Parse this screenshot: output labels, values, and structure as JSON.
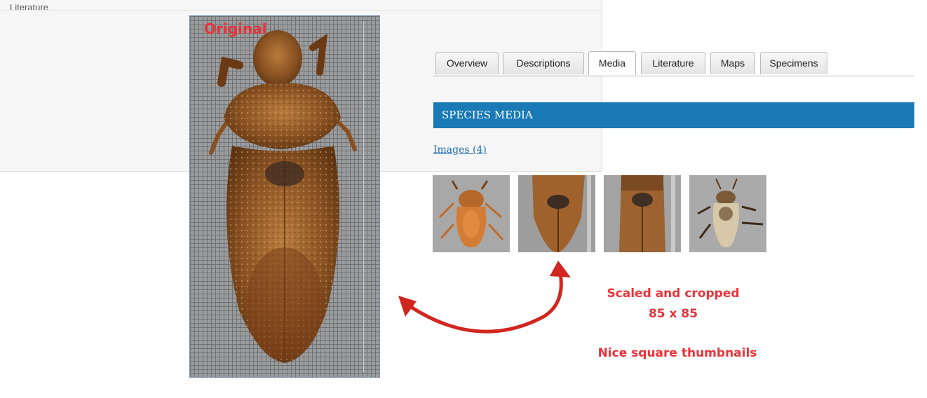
{
  "background_panel": {
    "label": "Literature"
  },
  "original": {
    "label": "Original"
  },
  "tabs": [
    {
      "label": "Overview"
    },
    {
      "label": "Descriptions"
    },
    {
      "label": "Media"
    },
    {
      "label": "Literature"
    },
    {
      "label": "Maps"
    },
    {
      "label": "Specimens"
    }
  ],
  "active_tab": "Media",
  "media": {
    "header": "SPECIES MEDIA",
    "images_link": "Images (4)",
    "thumbnails": [
      {
        "name": "thumbnail-1"
      },
      {
        "name": "thumbnail-2"
      },
      {
        "name": "thumbnail-3"
      },
      {
        "name": "thumbnail-4"
      }
    ]
  },
  "annotations": {
    "line1": "Scaled and cropped",
    "line2": "85 x 85",
    "line3": "Nice square thumbnails"
  },
  "colors": {
    "header_bg": "#1a7ab6",
    "annotation": "#e8333b",
    "link": "#1f6fb3"
  }
}
